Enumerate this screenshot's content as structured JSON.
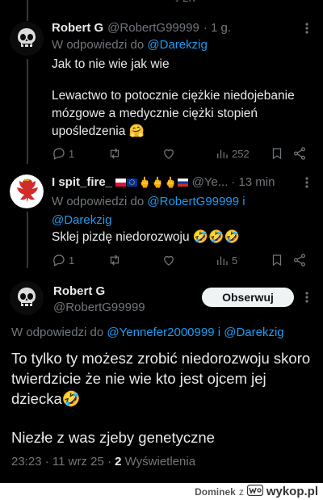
{
  "reply1": {
    "name": "Robert G",
    "handle": "@RobertG99999",
    "time": "· 1 g.",
    "reply_to_prefix": "W odpowiedzi do",
    "reply_to_user": "@Darekzig",
    "text_line1": "Jak to nie wie jak wie",
    "text_para2": "Lewactwo to potocznie ciężkie niedojebanie mózgowe a medycznie ciężki stopień upośledzenia 🤗",
    "replies": "1",
    "views": "252"
  },
  "reply2": {
    "name": "I spit_fire_",
    "emoji_run": "🇵🇱🇪🇺🖕🖕🖕🇷🇺",
    "handle": "@Ye...",
    "time": "· 13 min",
    "reply_to_prefix": "W odpowiedzi do",
    "reply_to_user1": "@RobertG99999",
    "reply_to_join": "i",
    "reply_to_user2": "@Darekzig",
    "text": "Sklej pizdę niedorozwoju 🤣🤣🤣",
    "replies": "1",
    "views": "5"
  },
  "main": {
    "name": "Robert G",
    "handle": "@RobertG99999",
    "follow_label": "Obserwuj",
    "reply_to_prefix": "W odpowiedzi do",
    "reply_to_user1": "@Yennefer2000999",
    "reply_to_join": "i",
    "reply_to_user2": "@Darekzig",
    "text_para1": "To tylko ty możesz zrobić niedorozwoju skoro twierdzicie że nie wie kto jest ojcem jej dziecka🤣",
    "text_para2": "Niezłe z was zjeby genetyczne",
    "timestamp": "23:23 · 11 wrz 25 ·",
    "views_count": "2",
    "views_label": "Wyświetlenia"
  },
  "footer": {
    "author": "Dominek",
    "via": "z",
    "site": "wykop.pl"
  },
  "colors": {
    "background": "#000000",
    "text": "#e7e9ea",
    "muted": "#71767b",
    "link": "#1d9bf0",
    "follow_bg": "#eff3f4"
  },
  "icons": [
    "reply-icon",
    "retweet-icon",
    "like-icon",
    "views-icon",
    "bookmark-icon",
    "share-icon",
    "more-icon",
    "wykop-logo-icon"
  ]
}
